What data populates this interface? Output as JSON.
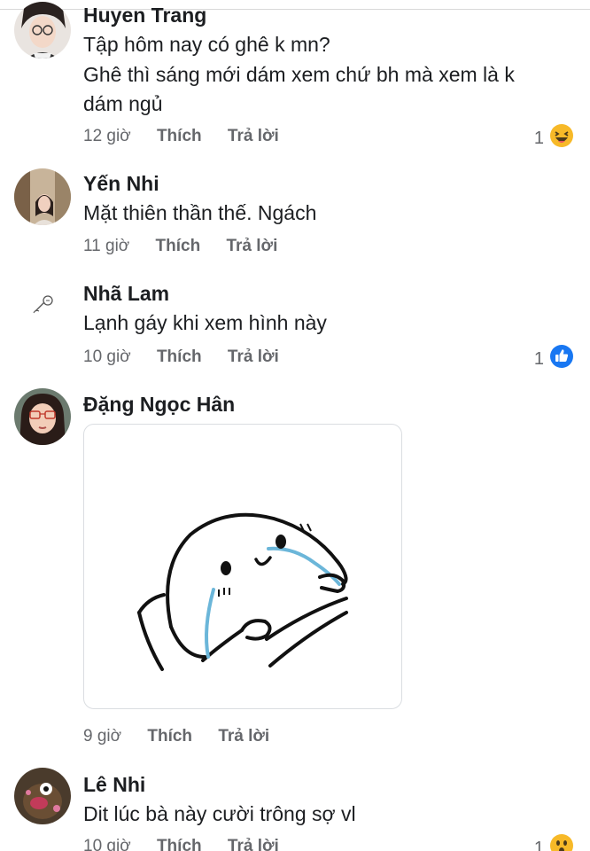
{
  "comments": [
    {
      "name": "Huyen Trang",
      "lines": [
        "Tập hôm nay có ghê k mn?",
        "Ghê thì sáng mới dám xem chứ bh mà xem là k",
        "dám ngủ"
      ],
      "time": "12 giờ",
      "like": "Thích",
      "reply": "Trả lời",
      "reaction_count": "1",
      "reaction_icon": "haha-icon"
    },
    {
      "name": "Yến Nhi",
      "lines": [
        "Mặt thiên thần thế. Ngách"
      ],
      "time": "11 giờ",
      "like": "Thích",
      "reply": "Trả lời"
    },
    {
      "name": "Nhã Lam",
      "lines": [
        "Lạnh gáy khi xem hình này"
      ],
      "time": "10 giờ",
      "like": "Thích",
      "reply": "Trả lời",
      "reaction_count": "1",
      "reaction_icon": "like-icon"
    },
    {
      "name": "Đặng Ngọc Hân",
      "lines": [],
      "sticker": "crying-blob-sticker",
      "time": "9 giờ",
      "like": "Thích",
      "reply": "Trả lời"
    },
    {
      "name": "Lê Nhi",
      "lines": [
        "Dit lúc bà này cười trông sợ vl"
      ],
      "time": "10 giờ",
      "like": "Thích",
      "reply": "Trả lời",
      "reaction_count": "1",
      "reaction_icon": "wow-icon"
    }
  ],
  "colors": {
    "text": "#1c1e21",
    "meta": "#65676b",
    "like_blue": "#1877f2",
    "haha_yellow": "#f7b928"
  }
}
